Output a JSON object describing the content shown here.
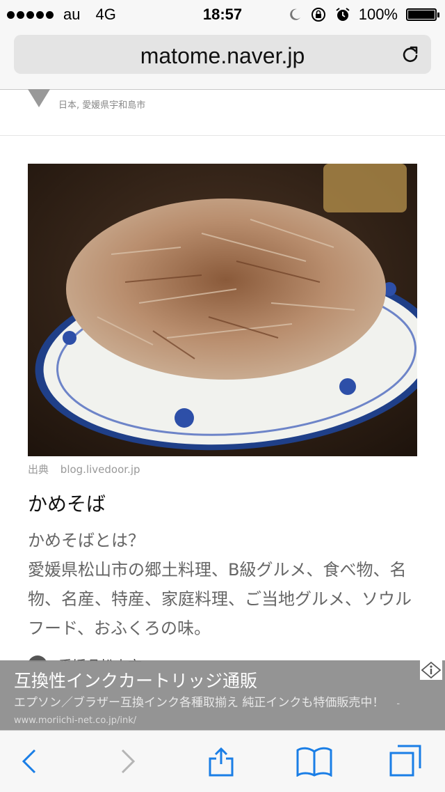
{
  "status": {
    "carrier": "au",
    "network": "4G",
    "time": "18:57",
    "battery": "100%"
  },
  "url_bar": {
    "domain": "matome.naver.jp"
  },
  "location": {
    "text": "日本, 愛媛県宇和島市"
  },
  "photo": {
    "description_icon": "food-photo"
  },
  "article": {
    "source_label": "出典",
    "source_domain": "blog.livedoor.jp",
    "title": "かめそば",
    "body": "かめそばとは？\n愛媛県松山市の郷土料理、B級グルメ、食べ物、名物、名産、特産、家庭料理、ご当地グルメ、ソウルフード、おふくろの味。",
    "next_item": "愛媛県松山市"
  },
  "ad": {
    "title": "互換性インクカートリッジ通販",
    "description": "エプソン／ブラザー互換インク各種取揃え 純正インクも特価販売中！",
    "url": "- www.moriichi-net.co.jp/ink/"
  },
  "colors": {
    "accent": "#1a7ee6",
    "ad_bg": "#8c8c8c",
    "toolbar_bg": "#f7f7f7"
  }
}
